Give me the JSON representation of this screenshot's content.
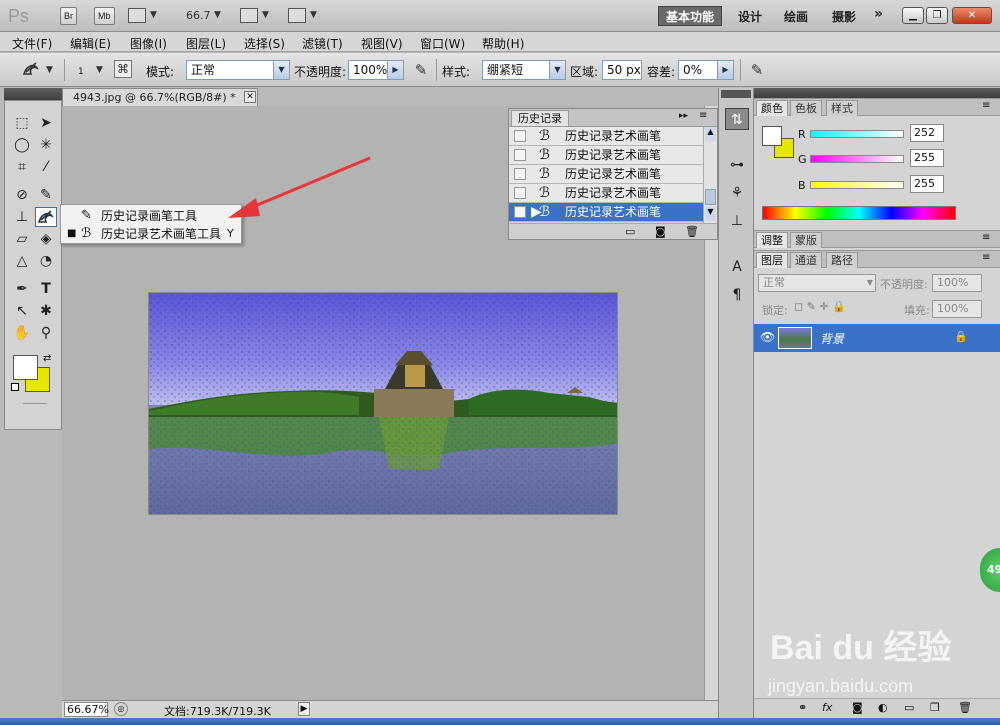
{
  "app": {
    "logo": "Ps",
    "bridge_label": "Br",
    "minibridge_label": "Mb",
    "zoom_value": "66.7",
    "workspaces": [
      "基本功能",
      "设计",
      "绘画",
      "摄影"
    ],
    "more_workspaces": "»"
  },
  "menu": [
    "文件(F)",
    "编辑(E)",
    "图像(I)",
    "图层(L)",
    "选择(S)",
    "滤镜(T)",
    "视图(V)",
    "窗口(W)",
    "帮助(H)"
  ],
  "options": {
    "brush_size": "1",
    "mode_label": "模式:",
    "mode_value": "正常",
    "opacity_label": "不透明度:",
    "opacity_value": "100%",
    "style_label": "样式:",
    "style_value": "绷紧短",
    "area_label": "区域:",
    "area_value": "50 px",
    "tolerance_label": "容差:",
    "tolerance_value": "0%"
  },
  "document": {
    "tab_title": "4943.jpg @ 66.7%(RGB/8#) *",
    "zoom_status": "66.67%",
    "doc_size": "文档:719.3K/719.3K"
  },
  "flyout": {
    "items": [
      {
        "label": "历史记录画笔工具",
        "shortcut": ""
      },
      {
        "label": "历史记录艺术画笔工具",
        "shortcut": "Y"
      }
    ]
  },
  "history": {
    "tab": "历史记录",
    "rows": [
      "历史记录艺术画笔",
      "历史记录艺术画笔",
      "历史记录艺术画笔",
      "历史记录艺术画笔",
      "历史记录艺术画笔"
    ]
  },
  "color_panel": {
    "tabs": [
      "颜色",
      "色板",
      "样式"
    ],
    "r_label": "R",
    "r_value": "252",
    "g_label": "G",
    "g_value": "255",
    "b_label": "B",
    "b_value": "255"
  },
  "adjust_panel": {
    "tabs": [
      "调整",
      "蒙版"
    ]
  },
  "layers_panel": {
    "tabs": [
      "图层",
      "通道",
      "路径"
    ],
    "blend_mode": "正常",
    "opacity_label": "不透明度:",
    "opacity_value": "100%",
    "lock_label": "锁定:",
    "fill_label": "填充:",
    "fill_value": "100%",
    "layer_name": "背景"
  },
  "watermark": {
    "logo": "Bai du 经验",
    "url": "jingyan.baidu.com",
    "badge": "49"
  },
  "colors": {
    "foreground": "#ffffff",
    "background": "#e6e600",
    "selection": "#3a72c9",
    "arrow": "#e8353a"
  }
}
